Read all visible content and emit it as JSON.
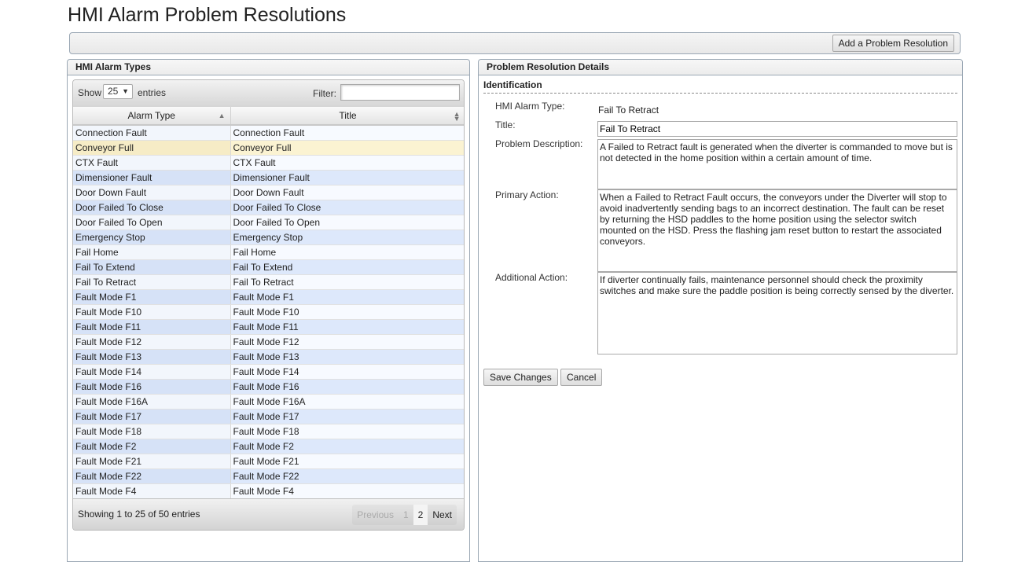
{
  "page": {
    "title": "HMI Alarm Problem Resolutions"
  },
  "toolbar": {
    "add_label": "Add a Problem Resolution"
  },
  "left_panel": {
    "header": "HMI Alarm Types",
    "show_label": "Show",
    "page_length": "25",
    "entries_label": "entries",
    "filter_label": "Filter:",
    "filter_value": "",
    "columns": [
      "Alarm Type",
      "Title"
    ],
    "rows": [
      [
        "Connection Fault",
        "Connection Fault"
      ],
      [
        "Conveyor Full",
        "Conveyor Full"
      ],
      [
        "CTX Fault",
        "CTX Fault"
      ],
      [
        "Dimensioner Fault",
        "Dimensioner Fault"
      ],
      [
        "Door Down Fault",
        "Door Down Fault"
      ],
      [
        "Door Failed To Close",
        "Door Failed To Close"
      ],
      [
        "Door Failed To Open",
        "Door Failed To Open"
      ],
      [
        "Emergency Stop",
        "Emergency Stop"
      ],
      [
        "Fail Home",
        "Fail Home"
      ],
      [
        "Fail To Extend",
        "Fail To Extend"
      ],
      [
        "Fail To Retract",
        "Fail To Retract"
      ],
      [
        "Fault Mode F1",
        "Fault Mode F1"
      ],
      [
        "Fault Mode F10",
        "Fault Mode F10"
      ],
      [
        "Fault Mode F11",
        "Fault Mode F11"
      ],
      [
        "Fault Mode F12",
        "Fault Mode F12"
      ],
      [
        "Fault Mode F13",
        "Fault Mode F13"
      ],
      [
        "Fault Mode F14",
        "Fault Mode F14"
      ],
      [
        "Fault Mode F16",
        "Fault Mode F16"
      ],
      [
        "Fault Mode F16A",
        "Fault Mode F16A"
      ],
      [
        "Fault Mode F17",
        "Fault Mode F17"
      ],
      [
        "Fault Mode F18",
        "Fault Mode F18"
      ],
      [
        "Fault Mode F2",
        "Fault Mode F2"
      ],
      [
        "Fault Mode F21",
        "Fault Mode F21"
      ],
      [
        "Fault Mode F22",
        "Fault Mode F22"
      ],
      [
        "Fault Mode F4",
        "Fault Mode F4"
      ]
    ],
    "highlighted_row": "Conveyor Full",
    "info": "Showing 1 to 25 of 50 entries",
    "pager": {
      "previous": "Previous",
      "pages": [
        "1",
        "2"
      ],
      "current_page": "2",
      "next": "Next"
    }
  },
  "right_panel": {
    "header": "Problem Resolution Details",
    "section": "Identification",
    "alarm_type_label": "HMI Alarm Type:",
    "alarm_type_value": "Fail To Retract",
    "title_label": "Title:",
    "title_value": "Fail To Retract",
    "description_label": "Problem Description:",
    "description_value": "A Failed to Retract fault is generated when the diverter is commanded to move but is not detected in the home position within a certain amount of time.",
    "primary_label": "Primary Action:",
    "primary_value": "When a Failed to Retract Fault occurs, the conveyors under the Diverter will stop to avoid inadvertently sending bags to an incorrect destination. The fault can be reset by returning the HSD paddles to the home position using the selector switch mounted on the HSD. Press the flashing jam reset button to restart the associated conveyors.",
    "additional_label": "Additional Action:",
    "additional_value": "If diverter continually fails, maintenance personnel should check the proximity switches and make sure the paddle position is being correctly sensed by the diverter.",
    "save_label": "Save Changes",
    "cancel_label": "Cancel"
  }
}
